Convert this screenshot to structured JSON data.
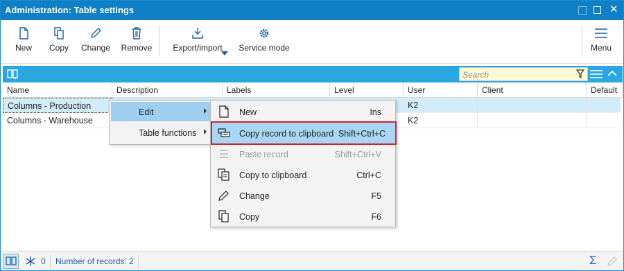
{
  "window": {
    "title": "Administration: Table settings"
  },
  "toolbar": {
    "new_label": "New",
    "copy_label": "Copy",
    "change_label": "Change",
    "remove_label": "Remove",
    "export_label": "Export/import",
    "service_label": "Service mode",
    "menu_label": "Menu"
  },
  "grid": {
    "search_placeholder": "Search",
    "columns": [
      "Name",
      "Description",
      "Labels",
      "Level",
      "User",
      "Client",
      "Default"
    ],
    "rows": [
      {
        "name": "Columns - Production",
        "user": "K2"
      },
      {
        "name": "Columns - Warehouse",
        "user": "K2"
      }
    ]
  },
  "context_menu": {
    "items": [
      {
        "label": "Edit"
      },
      {
        "label": "Table functions"
      }
    ]
  },
  "submenu": {
    "items": [
      {
        "label": "New",
        "shortcut": "Ins"
      },
      {
        "label": "Copy record to clipboard",
        "shortcut": "Shift+Ctrl+C"
      },
      {
        "label": "Paste record",
        "shortcut": "Shift+Ctrl+V"
      },
      {
        "label": "Copy to clipboard",
        "shortcut": "Ctrl+C"
      },
      {
        "label": "Change",
        "shortcut": "F5"
      },
      {
        "label": "Copy",
        "shortcut": "F6"
      }
    ]
  },
  "status": {
    "filter_count": "0",
    "records": "Number of records: 2"
  },
  "colors": {
    "titlebar": "#0f7fc6",
    "strip": "#2aa7e0",
    "highlight": "#a8d6f4",
    "callout": "#d7212c"
  }
}
